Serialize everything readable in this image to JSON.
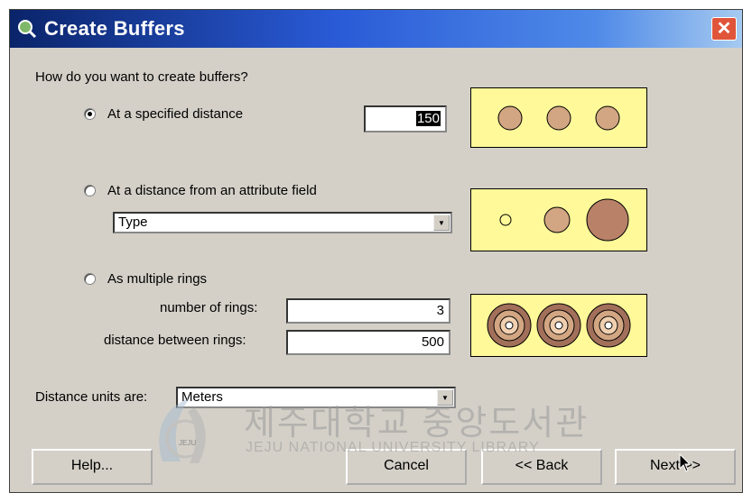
{
  "window": {
    "title": "Create Buffers",
    "close_label": "✕"
  },
  "question": "How do you want to create buffers?",
  "options": {
    "specified_distance": {
      "label": "At a specified distance",
      "value": "150",
      "selected": true
    },
    "attribute_field": {
      "label": "At a distance from an attribute field",
      "field_value": "Type",
      "selected": false
    },
    "multiple_rings": {
      "label": "As multiple rings",
      "selected": false,
      "rings_label": "number of rings:",
      "rings_value": "3",
      "distance_label": "distance between rings:",
      "distance_value": "500"
    }
  },
  "units": {
    "label": "Distance units are:",
    "value": "Meters"
  },
  "buttons": {
    "help": "Help...",
    "cancel": "Cancel",
    "back": "<< Back",
    "next": "Next >>"
  },
  "watermark": {
    "korean": "제주대학교 중앙도서관",
    "english": "JEJU NATIONAL UNIVERSITY LIBRARY",
    "logo_text": "JEJU"
  },
  "colors": {
    "title_start": "#0a246a",
    "preview_bg": "#fff999",
    "circle_fill": "#d2a682",
    "circle_dark": "#a2705a"
  },
  "icons": {
    "title": "magnifier-globe-icon",
    "close": "close-icon",
    "combo_arrow": "chevron-down-icon",
    "cursor": "mouse-cursor-icon"
  }
}
